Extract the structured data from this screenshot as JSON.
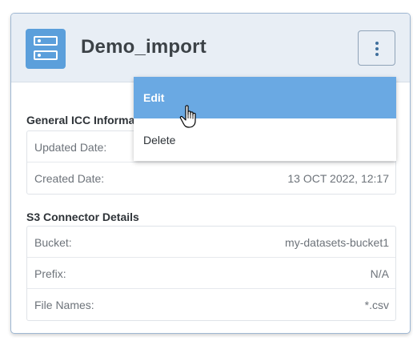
{
  "card": {
    "title": "Demo_import",
    "icon": "server-icon",
    "accent_color": "#5b9fdb"
  },
  "menu": {
    "trigger_icon": "kebab-vertical-icon",
    "items": [
      {
        "label": "Edit",
        "state": "hovered"
      },
      {
        "label": "Delete",
        "state": "normal"
      }
    ],
    "highlight_color": "#6aa9e3"
  },
  "general_section": {
    "title": "General ICC Informa",
    "rows": [
      {
        "label": "Updated Date:",
        "value": ""
      },
      {
        "label": "Created Date:",
        "value": "13 OCT 2022, 12:17"
      }
    ]
  },
  "s3_section": {
    "title": "S3 Connector Details",
    "rows": [
      {
        "label": "Bucket:",
        "value": "my-datasets-bucket1"
      },
      {
        "label": "Prefix:",
        "value": "N/A"
      },
      {
        "label": "File Names:",
        "value": "*.csv"
      }
    ]
  },
  "pointer": {
    "icon": "hand-pointer-icon"
  }
}
